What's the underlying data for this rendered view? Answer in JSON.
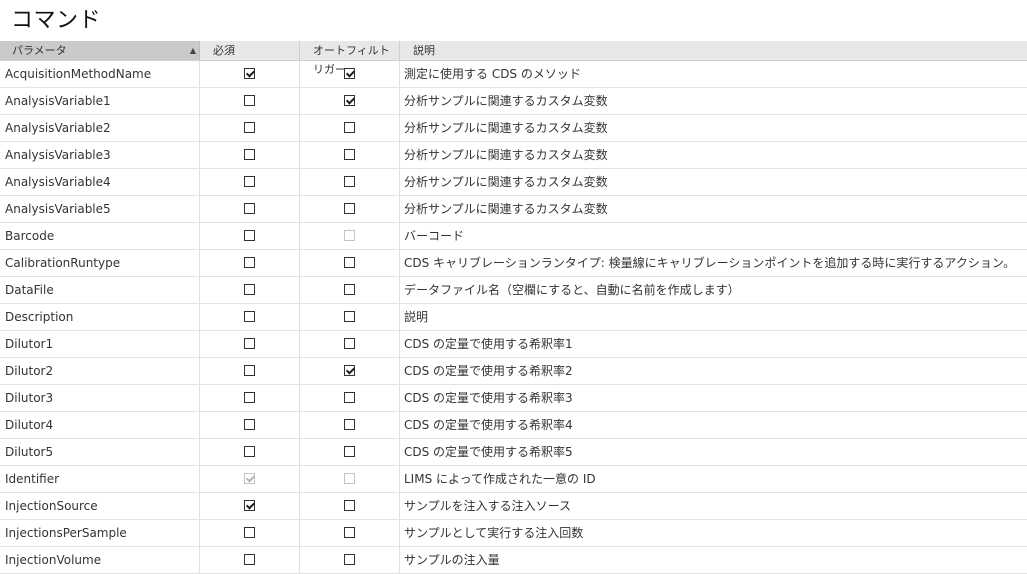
{
  "title": "コマンド",
  "columns": [
    "パラメータ",
    "必須",
    "オートフィルトリガー",
    "説明"
  ],
  "rows": [
    {
      "name": "AcquisitionMethodName",
      "required": true,
      "required_disabled": false,
      "trigger": true,
      "trigger_disabled": false,
      "description": "測定に使用する CDS のメソッド"
    },
    {
      "name": "AnalysisVariable1",
      "required": false,
      "required_disabled": false,
      "trigger": true,
      "trigger_disabled": false,
      "description": "分析サンプルに関連するカスタム変数"
    },
    {
      "name": "AnalysisVariable2",
      "required": false,
      "required_disabled": false,
      "trigger": false,
      "trigger_disabled": false,
      "description": "分析サンプルに関連するカスタム変数"
    },
    {
      "name": "AnalysisVariable3",
      "required": false,
      "required_disabled": false,
      "trigger": false,
      "trigger_disabled": false,
      "description": "分析サンプルに関連するカスタム変数"
    },
    {
      "name": "AnalysisVariable4",
      "required": false,
      "required_disabled": false,
      "trigger": false,
      "trigger_disabled": false,
      "description": "分析サンプルに関連するカスタム変数"
    },
    {
      "name": "AnalysisVariable5",
      "required": false,
      "required_disabled": false,
      "trigger": false,
      "trigger_disabled": false,
      "description": "分析サンプルに関連するカスタム変数"
    },
    {
      "name": "Barcode",
      "required": false,
      "required_disabled": false,
      "trigger": false,
      "trigger_disabled": true,
      "description": "バーコード"
    },
    {
      "name": "CalibrationRuntype",
      "required": false,
      "required_disabled": false,
      "trigger": false,
      "trigger_disabled": false,
      "description": "CDS キャリブレーションランタイプ: 検量線にキャリブレーションポイントを追加する時に実行するアクション。"
    },
    {
      "name": "DataFile",
      "required": false,
      "required_disabled": false,
      "trigger": false,
      "trigger_disabled": false,
      "description": "データファイル名（空欄にすると、自動に名前を作成します）"
    },
    {
      "name": "Description",
      "required": false,
      "required_disabled": false,
      "trigger": false,
      "trigger_disabled": false,
      "description": "説明"
    },
    {
      "name": "Dilutor1",
      "required": false,
      "required_disabled": false,
      "trigger": false,
      "trigger_disabled": false,
      "description": "CDS の定量で使用する希釈率1"
    },
    {
      "name": "Dilutor2",
      "required": false,
      "required_disabled": false,
      "trigger": true,
      "trigger_disabled": false,
      "description": "CDS の定量で使用する希釈率2"
    },
    {
      "name": "Dilutor3",
      "required": false,
      "required_disabled": false,
      "trigger": false,
      "trigger_disabled": false,
      "description": "CDS の定量で使用する希釈率3"
    },
    {
      "name": "Dilutor4",
      "required": false,
      "required_disabled": false,
      "trigger": false,
      "trigger_disabled": false,
      "description": "CDS の定量で使用する希釈率4"
    },
    {
      "name": "Dilutor5",
      "required": false,
      "required_disabled": false,
      "trigger": false,
      "trigger_disabled": false,
      "description": "CDS の定量で使用する希釈率5"
    },
    {
      "name": "Identifier",
      "required": true,
      "required_disabled": true,
      "trigger": false,
      "trigger_disabled": true,
      "description": "LIMS によって作成された一意の ID"
    },
    {
      "name": "InjectionSource",
      "required": true,
      "required_disabled": false,
      "trigger": false,
      "trigger_disabled": false,
      "description": "サンプルを注入する注入ソース"
    },
    {
      "name": "InjectionsPerSample",
      "required": false,
      "required_disabled": false,
      "trigger": false,
      "trigger_disabled": false,
      "description": "サンプルとして実行する注入回数"
    },
    {
      "name": "InjectionVolume",
      "required": false,
      "required_disabled": false,
      "trigger": false,
      "trigger_disabled": false,
      "description": "サンプルの注入量"
    }
  ]
}
